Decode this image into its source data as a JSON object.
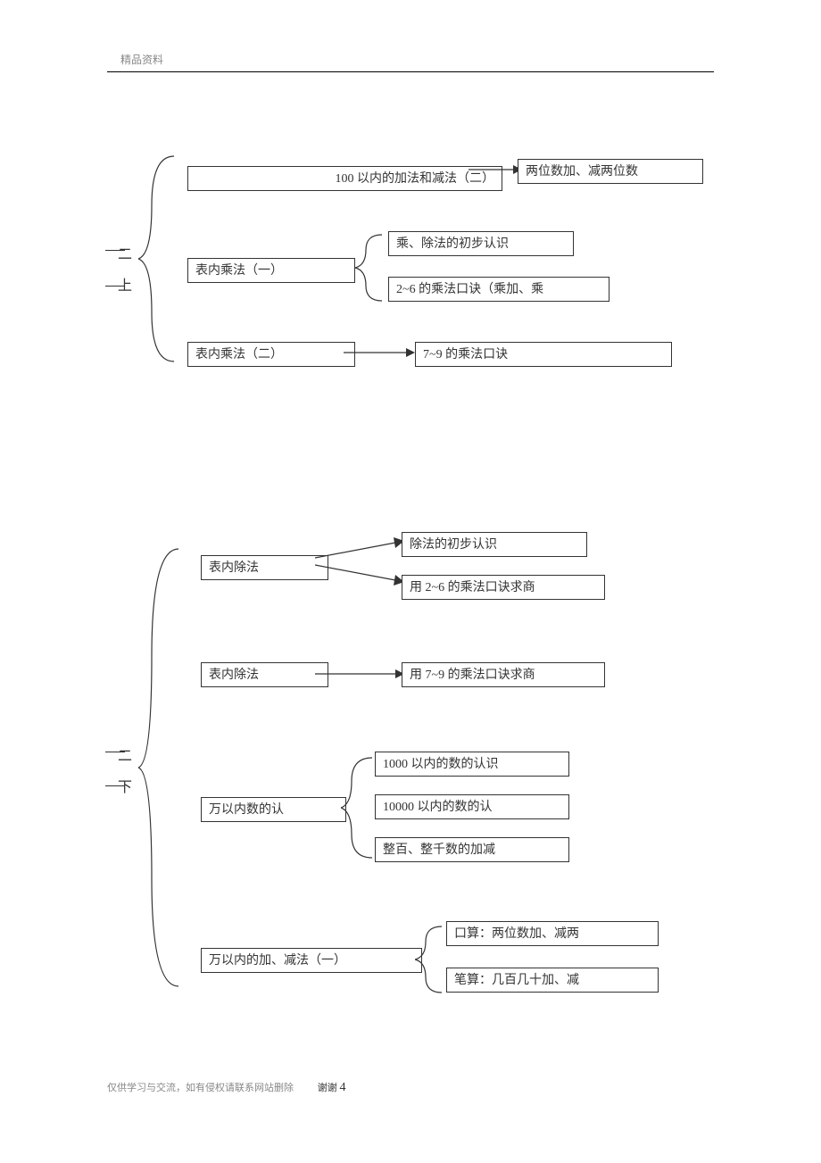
{
  "header": "精品资料",
  "footer_left": "仅供学习与交流，如有侵权请联系网站删除",
  "footer_right": "谢谢",
  "page_num": "4",
  "section1": {
    "side_a": "二",
    "side_b": "上",
    "row1": {
      "main": "100 以内的加法和减法（二）",
      "right": "两位数加、减两位数"
    },
    "row2": {
      "main": "表内乘法（一）",
      "right_a": "乘、除法的初步认识",
      "right_b": "2~6 的乘法口诀（乘加、乘"
    },
    "row3": {
      "main": "表内乘法（二）",
      "right": "7~9 的乘法口诀"
    }
  },
  "section2": {
    "side_a": "二",
    "side_b": "下",
    "row1": {
      "main": "表内除法",
      "right_a": "除法的初步认识",
      "right_b": "用 2~6 的乘法口诀求商"
    },
    "row2": {
      "main": "表内除法",
      "right": "用 7~9 的乘法口诀求商"
    },
    "row3": {
      "main": "万以内数的认",
      "right_a": "1000 以内的数的认识",
      "right_b": "10000 以内的数的认",
      "right_c": "整百、整千数的加减"
    },
    "row4": {
      "main": "万以内的加、减法（一）",
      "right_a": "口算：两位数加、减两",
      "right_b": "笔算：几百几十加、减"
    }
  }
}
